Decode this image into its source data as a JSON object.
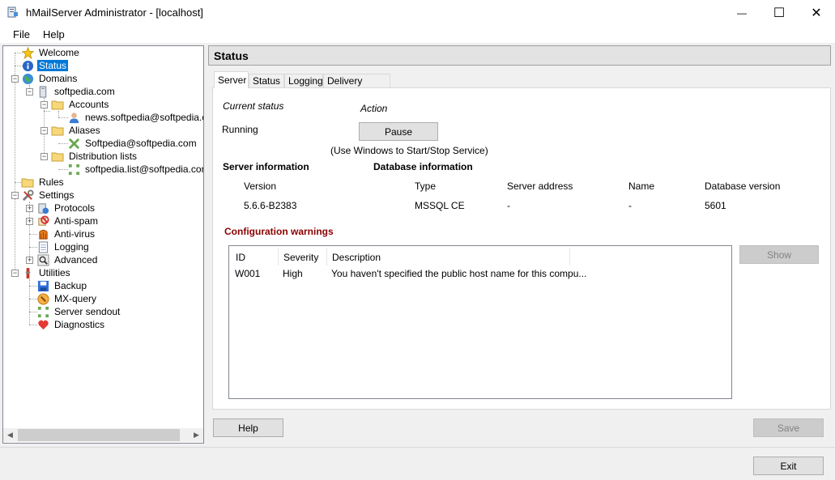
{
  "window": {
    "title": "hMailServer Administrator - [localhost]",
    "minimize_glyph": "—",
    "maximize_glyph": "☐",
    "close_glyph": "✕"
  },
  "menu": [
    "File",
    "Help"
  ],
  "tree": {
    "welcome": "Welcome",
    "status": "Status",
    "domains": "Domains",
    "domain_name": "softpedia.com",
    "accounts": "Accounts",
    "account_item": "news.softpedia@softpedia.com",
    "aliases": "Aliases",
    "alias_item": "Softpedia@softpedia.com",
    "distribution_lists": "Distribution lists",
    "list_item": "softpedia.list@softpedia.com",
    "rules": "Rules",
    "settings": "Settings",
    "protocols": "Protocols",
    "antispam": "Anti-spam",
    "antivirus": "Anti-virus",
    "logging": "Logging",
    "advanced": "Advanced",
    "utilities": "Utilities",
    "backup": "Backup",
    "mxquery": "MX-query",
    "server_sendout": "Server sendout",
    "diagnostics": "Diagnostics"
  },
  "panel": {
    "header": "Status",
    "tabs": [
      "Server",
      "Status",
      "Logging",
      "Delivery queue"
    ],
    "current_status_label": "Current status",
    "action_label": "Action",
    "current_status_value": "Running",
    "pause_button": "Pause",
    "service_note": "(Use Windows to Start/Stop Service)",
    "server_info_title": "Server information",
    "database_info_title": "Database information",
    "version_label": "Version",
    "version_value": "5.6.6-B2383",
    "db_columns": [
      "Type",
      "Server address",
      "Name",
      "Database version"
    ],
    "db_values": [
      "MSSQL CE",
      "-",
      "-",
      "5601"
    ],
    "config_warnings_title": "Configuration warnings",
    "warnings_columns": [
      "ID",
      "Severity",
      "Description"
    ],
    "warnings": [
      {
        "id": "W001",
        "severity": "High",
        "description": "You haven't specified the public host name for this compu..."
      }
    ],
    "show_button": "Show",
    "help_button": "Help",
    "save_button": "Save"
  },
  "footer": {
    "exit_button": "Exit"
  },
  "colors": {
    "selection": "#0078d7",
    "warning_title": "#8b0000"
  }
}
